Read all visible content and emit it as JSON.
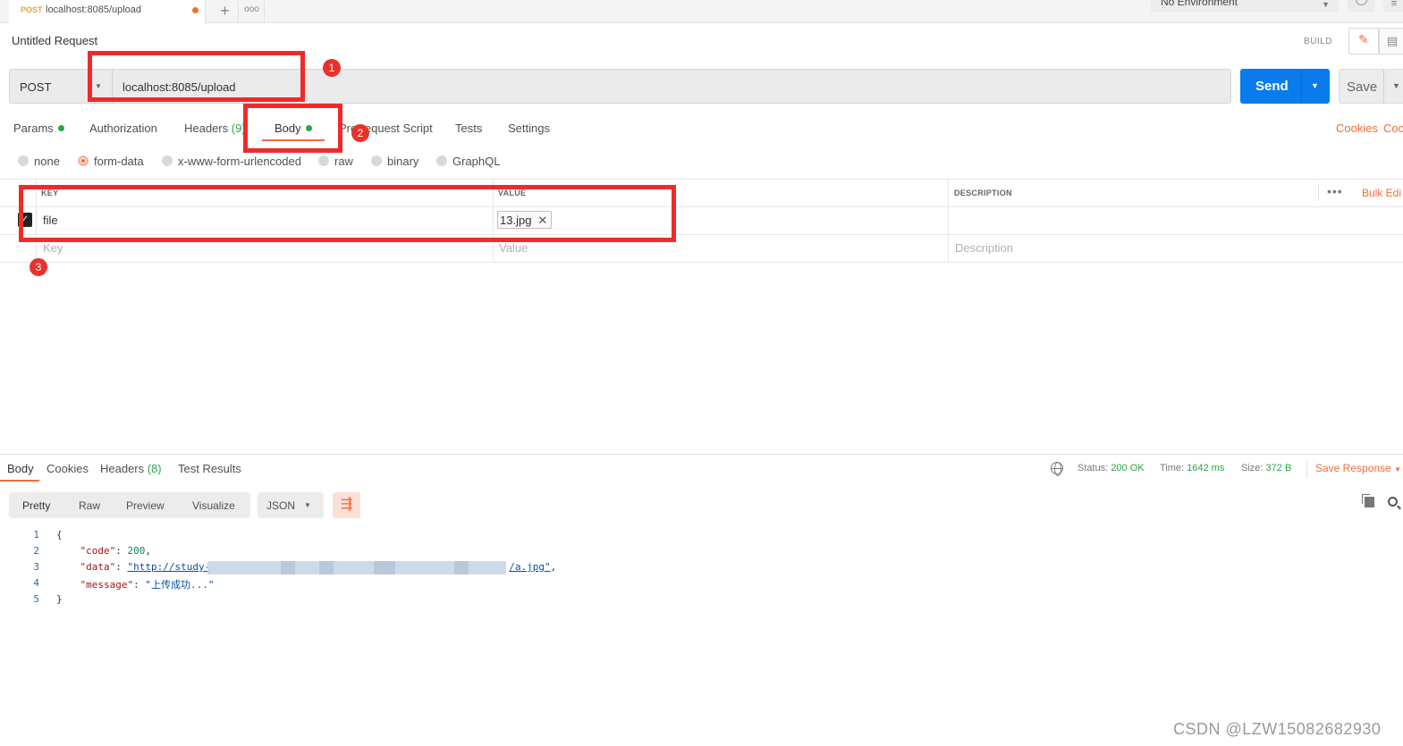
{
  "top_tab": {
    "method": "POST",
    "url": "localhost:8085/upload"
  },
  "top_icons": {
    "plus": "+",
    "more": "ooo"
  },
  "environment": {
    "selected": "No Environment"
  },
  "request": {
    "title": "Untitled Request",
    "build_label": "BUILD",
    "method": "POST",
    "url": "localhost:8085/upload",
    "send_label": "Send",
    "save_label": "Save"
  },
  "request_tabs": [
    {
      "label": "Params",
      "dot": true
    },
    {
      "label": "Authorization"
    },
    {
      "label": "Headers ",
      "count": "(9)"
    },
    {
      "label": "Body",
      "dot": true,
      "active": true
    },
    {
      "label": "Pre-request Script"
    },
    {
      "label": "Tests"
    },
    {
      "label": "Settings"
    }
  ],
  "right_links": {
    "cookies": "Cookies",
    "code": "Coc"
  },
  "body_types": [
    {
      "label": "none"
    },
    {
      "label": "form-data",
      "selected": true
    },
    {
      "label": "x-www-form-urlencoded"
    },
    {
      "label": "raw"
    },
    {
      "label": "binary"
    },
    {
      "label": "GraphQL"
    }
  ],
  "table": {
    "headers": {
      "key": "KEY",
      "value": "VALUE",
      "description": "DESCRIPTION"
    },
    "bulk_more": "•••",
    "bulk_edit": "Bulk Edi",
    "rows": [
      {
        "checked": true,
        "key": "file",
        "value": "13.jpg",
        "description": ""
      }
    ],
    "placeholders": {
      "key": "Key",
      "value": "Value",
      "description": "Description"
    }
  },
  "annotations": {
    "badge1": "1",
    "badge2": "2",
    "badge3": "3",
    "color": "#ee2b2b"
  },
  "response": {
    "tabs": [
      {
        "label": "Body",
        "active": true
      },
      {
        "label": "Cookies"
      },
      {
        "label": "Headers ",
        "count": "(8)"
      },
      {
        "label": "Test Results"
      }
    ],
    "status_label": "Status:",
    "status_value": "200 OK",
    "time_label": "Time:",
    "time_value": "1642 ms",
    "size_label": "Size:",
    "size_value": "372 B",
    "save_response": "Save Response",
    "view_tabs": [
      "Pretty",
      "Raw",
      "Preview",
      "Visualize"
    ],
    "language": "JSON",
    "code_lines": [
      {
        "n": "1",
        "text": "{"
      },
      {
        "n": "2",
        "key": "\"code\"",
        "value": "200"
      },
      {
        "n": "3",
        "key": "\"data\"",
        "value_start": "\"http://study-",
        "value_end": "/a.jpg\""
      },
      {
        "n": "4",
        "key": "\"message\"",
        "value": "\"上传成功...\""
      },
      {
        "n": "5",
        "text": "}"
      }
    ]
  },
  "watermark": "CSDN @LZW15082682930",
  "colors": {
    "accent": "#f26b3a",
    "send": "#097bed",
    "green": "#27a844"
  }
}
